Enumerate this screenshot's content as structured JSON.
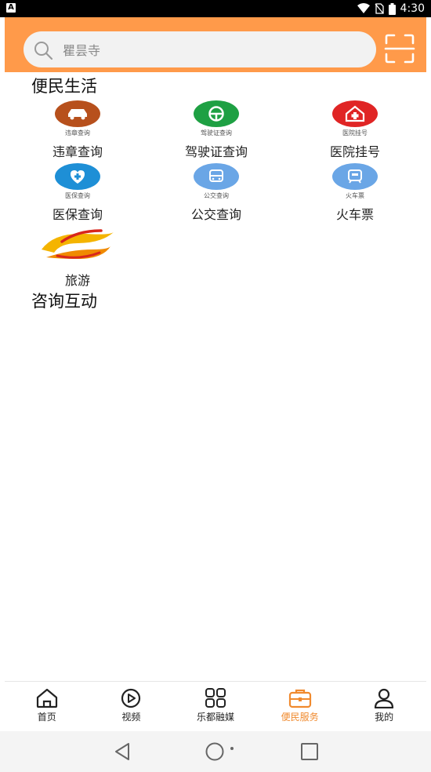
{
  "status_bar": {
    "left_badge": "A",
    "time": "4:30"
  },
  "search": {
    "placeholder": "瞿昙寺"
  },
  "sections": [
    {
      "title": "便民生活",
      "services": [
        {
          "label": "违章查询",
          "icon_text": "违章查询",
          "icon": "car-icon",
          "color": "#b7501c"
        },
        {
          "label": "驾驶证查询",
          "icon_text": "驾驶证查询",
          "icon": "steering-wheel-icon",
          "color": "#1ea043"
        },
        {
          "label": "医院挂号",
          "icon_text": "医院挂号",
          "icon": "hospital-icon",
          "color": "#e02525"
        },
        {
          "label": "医保查询",
          "icon_text": "医保查询",
          "icon": "medical-insurance-icon",
          "color": "#1e8fd6"
        },
        {
          "label": "公交查询",
          "icon_text": "公交查询",
          "icon": "bus-icon",
          "color": "#6aa6e6"
        },
        {
          "label": "火车票",
          "icon_text": "火车票",
          "icon": "train-icon",
          "color": "#6aa6e6"
        },
        {
          "label": "旅游",
          "icon": "travel-logo-icon"
        }
      ]
    },
    {
      "title": "咨询互动",
      "services": []
    }
  ],
  "bottom_nav": [
    {
      "label": "首页",
      "icon": "home-icon",
      "active": false
    },
    {
      "label": "视频",
      "icon": "play-icon",
      "active": false
    },
    {
      "label": "乐都融媒",
      "icon": "grid-icon",
      "active": false
    },
    {
      "label": "便民服务",
      "icon": "briefcase-icon",
      "active": true
    },
    {
      "label": "我的",
      "icon": "user-icon",
      "active": false
    }
  ],
  "colors": {
    "header": "#ff9a4a",
    "accent": "#f08a2e"
  }
}
